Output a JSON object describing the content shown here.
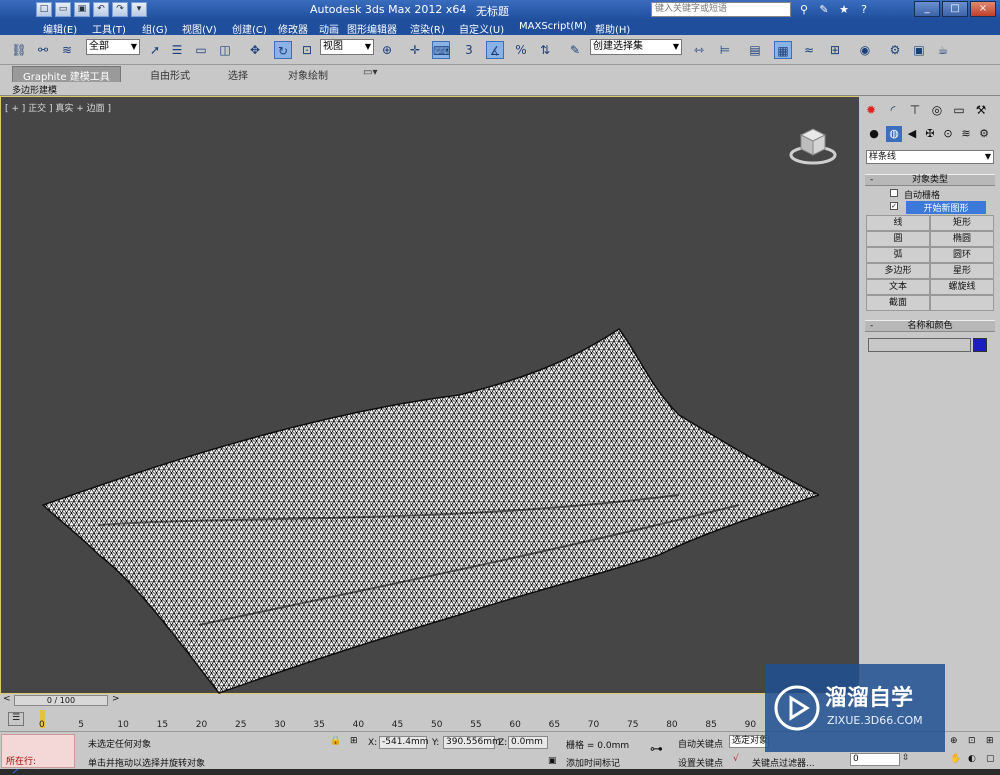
{
  "titlebar": {
    "app_title": "Autodesk 3ds Max  2012 x64",
    "doc_title": "无标题",
    "search_placeholder": "键入关键字或短语"
  },
  "menu": [
    "编辑(E)",
    "工具(T)",
    "组(G)",
    "视图(V)",
    "创建(C)",
    "修改器",
    "动画",
    "图形编辑器",
    "渲染(R)",
    "自定义(U)",
    "MAXScript(M)",
    "帮助(H)"
  ],
  "toolbar": {
    "selection_filter": "全部",
    "ref_coord": "视图",
    "named_set": "创建选择集",
    "snap_3": "3",
    "snap_percent": "%"
  },
  "ribbon": {
    "tabs": [
      "Graphite 建模工具",
      "自由形式",
      "选择",
      "对象绘制"
    ],
    "sub": "多边形建模"
  },
  "viewport": {
    "label": "[ + ] 正交 ] 真实 + 边面 ]"
  },
  "cmdpanel": {
    "category": "样条线",
    "object_type_title": "对象类型",
    "auto_grid": "自动栅格",
    "start_new_shape": "开始新图形",
    "buttons": [
      "线",
      "矩形",
      "圆",
      "椭圆",
      "弧",
      "圆环",
      "多边形",
      "星形",
      "文本",
      "螺旋线",
      "截面",
      ""
    ],
    "name_color_title": "名称和颜色",
    "color": "#1b1ebf"
  },
  "timeline": {
    "position": "0 / 100",
    "ticks": [
      "0",
      "5",
      "10",
      "15",
      "20",
      "25",
      "30",
      "35",
      "40",
      "45",
      "50",
      "55",
      "60",
      "65",
      "70",
      "75",
      "80",
      "85",
      "90"
    ]
  },
  "status": {
    "running": "所在行:",
    "selection": "未选定任何对象",
    "prompt": "单击并拖动以选择并旋转对象",
    "x_label": "X:",
    "x": "-541.4mm",
    "y_label": "Y:",
    "y": "390.556mm",
    "z_label": "Z:",
    "z": "0.0mm",
    "grid": "栅格 = 0.0mm",
    "add_time_tag": "添加时间标记",
    "auto_key": "自动关键点",
    "selected": "选定对象",
    "set_key": "设置关键点",
    "key_filters": "关键点过滤器...",
    "frame": "0"
  },
  "watermark": {
    "title": "溜溜自学",
    "url": "ZIXUE.3D66.COM"
  }
}
